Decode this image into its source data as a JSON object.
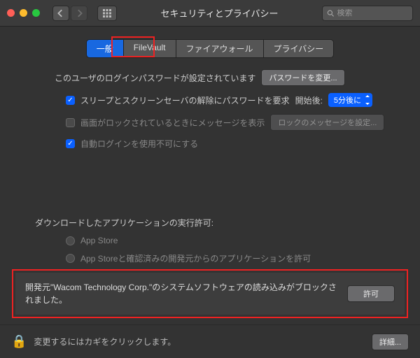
{
  "window": {
    "title": "セキュリティとプライバシー"
  },
  "search": {
    "placeholder": "検索"
  },
  "tabs": {
    "general": "一般",
    "filevault": "FileVault",
    "firewall": "ファイアウォール",
    "privacy": "プライバシー"
  },
  "login": {
    "status": "このユーザのログインパスワードが設定されています",
    "change_btn": "パスワードを変更...",
    "require_pw": "スリープとスクリーンセーバの解除にパスワードを要求",
    "start_after": "開始後:",
    "delay": "5分後に",
    "lock_msg": "画面がロックされているときにメッセージを表示",
    "lock_msg_btn": "ロックのメッセージを設定...",
    "auto_login": "自動ログインを使用不可にする"
  },
  "downloads": {
    "heading": "ダウンロードしたアプリケーションの実行許可:",
    "appstore": "App Store",
    "identified": "App Storeと確認済みの開発元からのアプリケーションを許可"
  },
  "blocked": {
    "text": "開発元\"Wacom Technology Corp.\"のシステムソフトウェアの読み込みがブロックされました。",
    "allow_btn": "許可"
  },
  "footer": {
    "text": "変更するにはカギをクリックします。",
    "advanced_btn": "詳細..."
  }
}
